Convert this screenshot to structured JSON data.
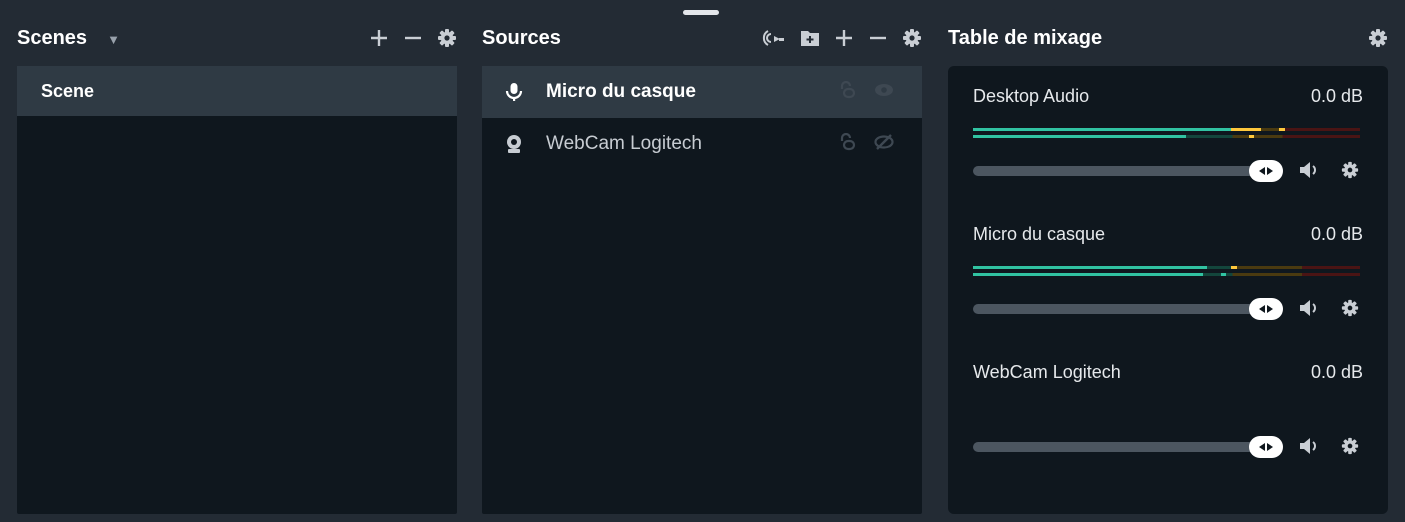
{
  "scenes": {
    "title": "Scenes",
    "items": [
      {
        "label": "Scene",
        "selected": true
      }
    ]
  },
  "sources": {
    "title": "Sources",
    "items": [
      {
        "label": "Micro du casque",
        "icon": "microphone-icon",
        "selected": true,
        "locked": false,
        "visible": true
      },
      {
        "label": "WebCam Logitech",
        "icon": "webcam-icon",
        "selected": false,
        "locked": false,
        "visible": false
      }
    ]
  },
  "mixer": {
    "title": "Table de mixage",
    "channels": [
      {
        "name": "Desktop Audio",
        "db": "0.0 dB",
        "level": 1.0
      },
      {
        "name": "Micro du casque",
        "db": "0.0 dB",
        "level": 1.0
      },
      {
        "name": "WebCam Logitech",
        "db": "0.0 dB",
        "level": 1.0
      }
    ]
  },
  "colors": {
    "background": "#232b34",
    "panel": "#0f171e",
    "selected_row": "#2f3a44",
    "meter_green": "#31c3a2",
    "meter_yellow": "#ffc83c",
    "meter_red": "#4a1414"
  }
}
